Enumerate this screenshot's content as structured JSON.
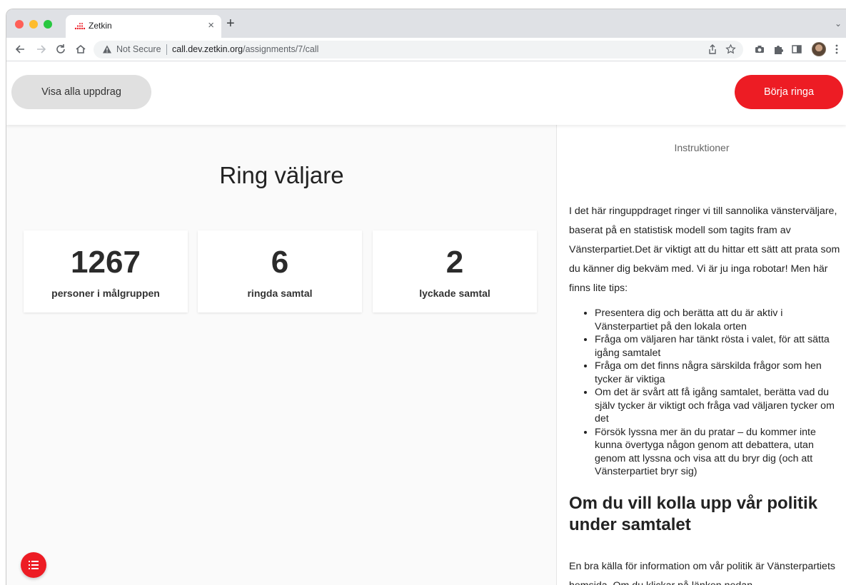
{
  "browser": {
    "tab_title": "Zetkin",
    "tab_close": "×",
    "new_tab": "+",
    "tab_menu": "⌄",
    "security_label": "Not Secure",
    "url_host": "call.dev.zetkin.org",
    "url_path": "/assignments/7/call",
    "traffic_lights": {
      "close": "#ff5f57",
      "minimize": "#febc2e",
      "maximize": "#28c840"
    },
    "icons": {
      "back": "arrow-left-icon",
      "forward": "arrow-right-icon",
      "reload": "reload-icon",
      "home": "home-icon",
      "warning": "warning-icon",
      "share": "share-icon",
      "bookmark": "star-icon",
      "camera": "camera-icon",
      "extensions": "puzzle-icon",
      "side_panel": "side-panel-icon",
      "profile": "avatar",
      "menu": "kebab-menu-icon"
    }
  },
  "header": {
    "back_label": "Visa alla uppdrag",
    "start_label": "Börja ringa"
  },
  "colors": {
    "accent": "#ed1c24",
    "secondary_button": "#e0e0e0"
  },
  "main": {
    "title": "Ring väljare",
    "stats": [
      {
        "value": "1267",
        "label": "personer i målgruppen"
      },
      {
        "value": "6",
        "label": "ringda samtal"
      },
      {
        "value": "2",
        "label": "lyckade samtal"
      }
    ],
    "fab_icon": "list-icon"
  },
  "sidebar": {
    "title": "Instruktioner",
    "intro": "I det här ringuppdraget ringer vi till sannolika vänsterväljare, baserat på en statistisk modell som tagits fram av Vänsterpartiet.Det är viktigt att du hittar ett sätt att prata som du känner dig bekväm med. Vi är ju inga robotar! Men här finns lite tips:",
    "tips": [
      "Presentera dig och berätta att du är aktiv i Vänsterpartiet på den lokala orten",
      "Fråga om väljaren har tänkt rösta i valet, för att sätta igång samtalet",
      "Fråga om det finns några särskilda frågor som hen tycker är viktiga",
      "Om det är svårt att få igång samtalet, berätta vad du själv tycker är viktigt och fråga vad väljaren tycker om det",
      "Försök lyssna mer än du pratar – du kommer inte kunna övertyga någon genom att debattera, utan genom att lyssna och visa att du bryr dig (och att Vänsterpartiet bryr sig)"
    ],
    "heading": "Om du vill kolla upp vår politik under samtalet",
    "outro": "En bra källa för information om vår politik är Vänsterpartiets hemsida. Om du klickar på länken nedan"
  }
}
